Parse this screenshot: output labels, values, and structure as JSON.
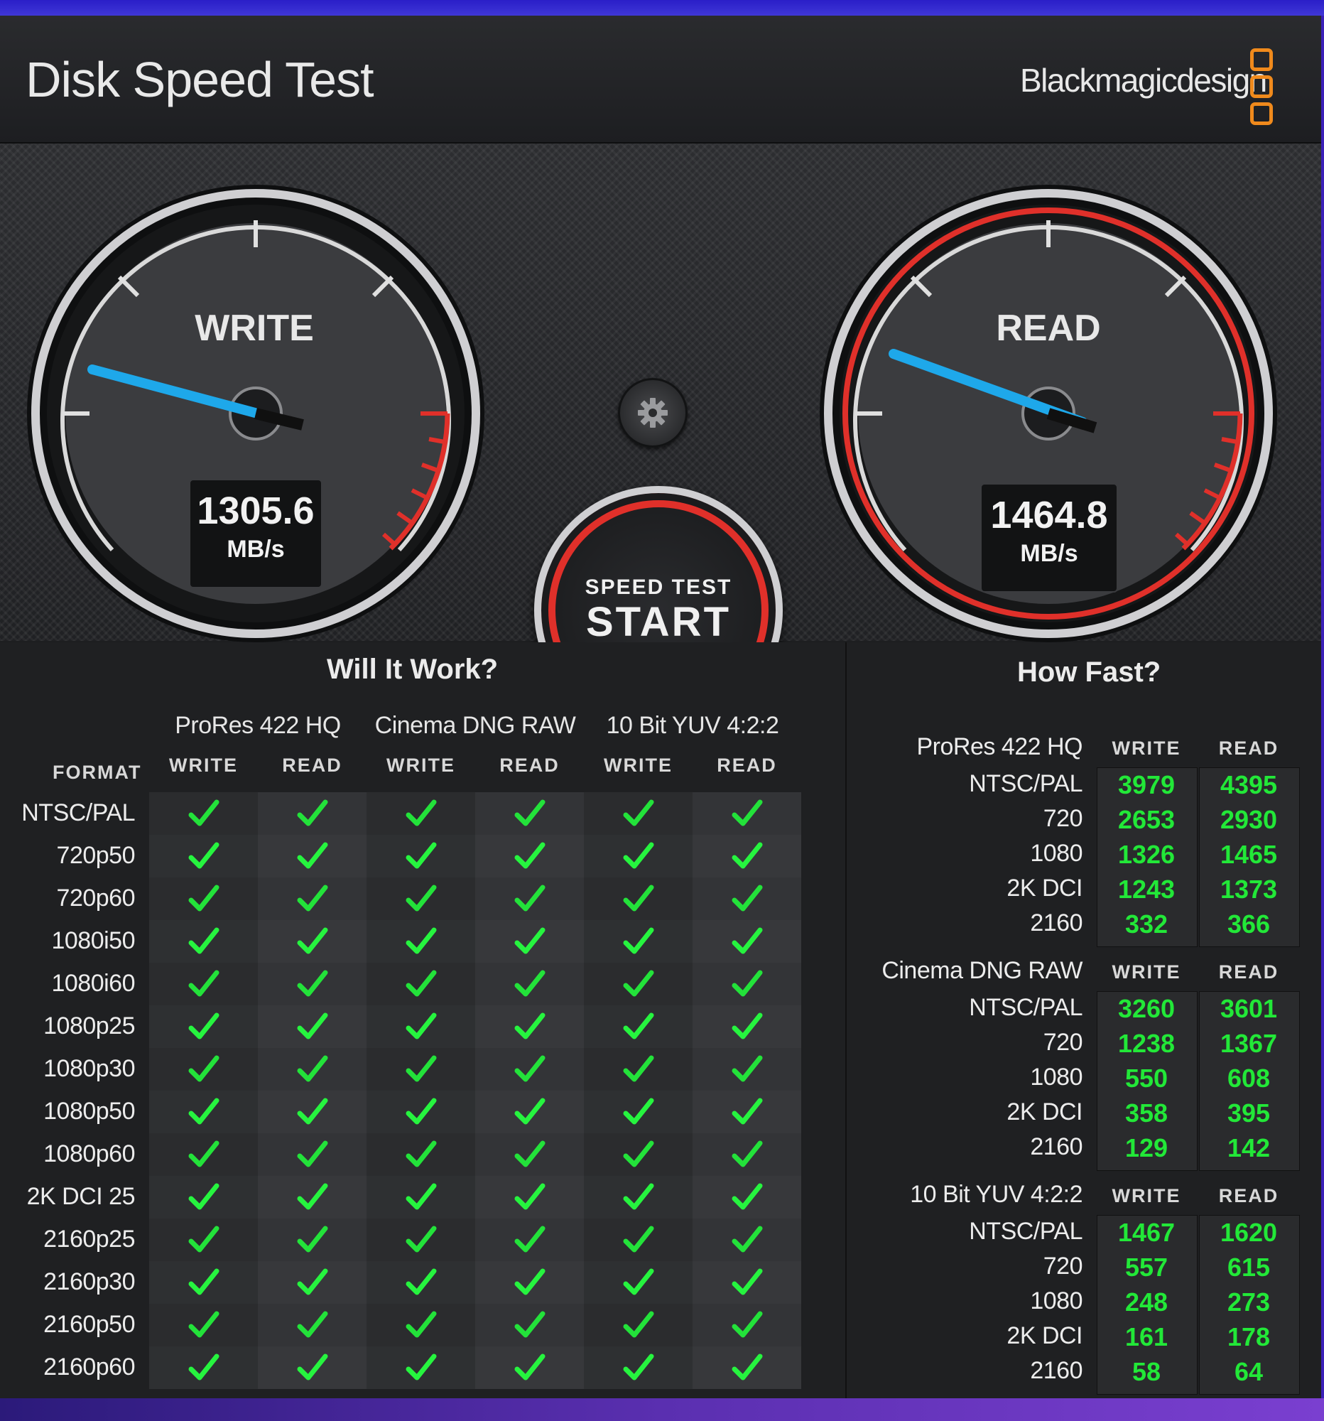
{
  "app": {
    "title": "Disk Speed Test",
    "brand": "Blackmagicdesign"
  },
  "gauges": {
    "write": {
      "label": "WRITE",
      "value": "1305.6",
      "unit": "MB/s"
    },
    "read": {
      "label": "READ",
      "value": "1464.8",
      "unit": "MB/s"
    }
  },
  "start_button": {
    "line1": "SPEED TEST",
    "line2": "START"
  },
  "will_it_work": {
    "title": "Will It Work?",
    "format_label": "FORMAT",
    "groups": [
      {
        "name": "ProRes 422 HQ",
        "cols": [
          "WRITE",
          "READ"
        ]
      },
      {
        "name": "Cinema DNG RAW",
        "cols": [
          "WRITE",
          "READ"
        ]
      },
      {
        "name": "10 Bit YUV 4:2:2",
        "cols": [
          "WRITE",
          "READ"
        ]
      }
    ],
    "rows": [
      "NTSC/PAL",
      "720p50",
      "720p60",
      "1080i50",
      "1080i60",
      "1080p25",
      "1080p30",
      "1080p50",
      "1080p60",
      "2K DCI 25",
      "2160p25",
      "2160p30",
      "2160p50",
      "2160p60"
    ],
    "check_icon": "check-icon",
    "check_color": "#23e23a"
  },
  "how_fast": {
    "title": "How Fast?",
    "sections": [
      {
        "name": "ProRes 422 HQ",
        "write_label": "WRITE",
        "read_label": "READ",
        "rows": [
          {
            "label": "NTSC/PAL",
            "write": "3979",
            "read": "4395"
          },
          {
            "label": "720",
            "write": "2653",
            "read": "2930"
          },
          {
            "label": "1080",
            "write": "1326",
            "read": "1465"
          },
          {
            "label": "2K DCI",
            "write": "1243",
            "read": "1373"
          },
          {
            "label": "2160",
            "write": "332",
            "read": "366"
          }
        ]
      },
      {
        "name": "Cinema DNG RAW",
        "write_label": "WRITE",
        "read_label": "READ",
        "rows": [
          {
            "label": "NTSC/PAL",
            "write": "3260",
            "read": "3601"
          },
          {
            "label": "720",
            "write": "1238",
            "read": "1367"
          },
          {
            "label": "1080",
            "write": "550",
            "read": "608"
          },
          {
            "label": "2K DCI",
            "write": "358",
            "read": "395"
          },
          {
            "label": "2160",
            "write": "129",
            "read": "142"
          }
        ]
      },
      {
        "name": "10 Bit YUV 4:2:2",
        "write_label": "WRITE",
        "read_label": "READ",
        "rows": [
          {
            "label": "NTSC/PAL",
            "write": "1467",
            "read": "1620"
          },
          {
            "label": "720",
            "write": "557",
            "read": "615"
          },
          {
            "label": "1080",
            "write": "248",
            "read": "273"
          },
          {
            "label": "2K DCI",
            "write": "161",
            "read": "178"
          },
          {
            "label": "2160",
            "write": "58",
            "read": "64"
          }
        ]
      }
    ]
  },
  "colors": {
    "needle": "#1ea8ea",
    "redline": "#e0302a",
    "value_green": "#22e838",
    "logo_orange": "#f08a1c"
  }
}
